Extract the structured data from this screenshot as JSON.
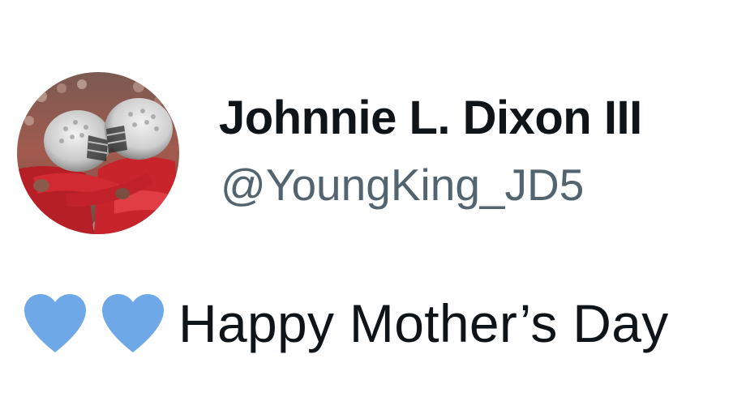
{
  "tweet": {
    "author": {
      "display_name": "Johnnie L. Dixon III",
      "handle": "@YoungKing_JD5",
      "avatar_icon": "avatar-photo-football-players-celebrating"
    },
    "body": {
      "emoji": [
        "blue-heart",
        "blue-heart"
      ],
      "emoji_color": "#6fa8e6",
      "text": "Happy Mother’s Day"
    }
  },
  "colors": {
    "name_text": "#0f1419",
    "handle_text": "#536471",
    "background": "#ffffff"
  }
}
